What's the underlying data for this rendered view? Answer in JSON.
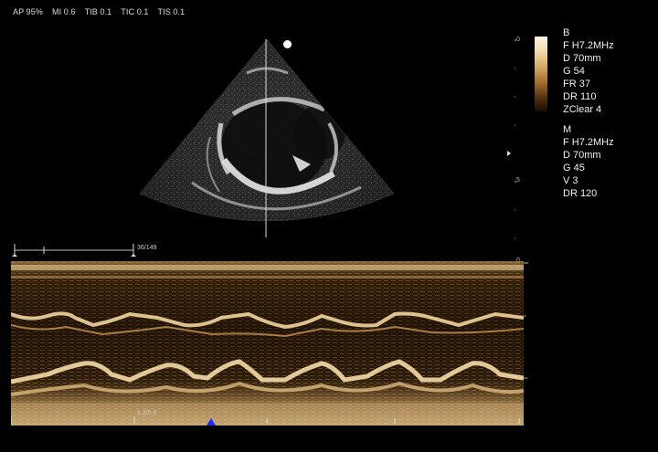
{
  "header": {
    "ap": "AP 95%",
    "mi": "MI 0.6",
    "tib": "TIB 0.1",
    "tic": "TIC 0.1",
    "tis": "TIS 0.1"
  },
  "bmode_params": {
    "title": "B",
    "freq": "F H7.2MHz",
    "depth": "D 70mm",
    "gain": "G 54",
    "frame_rate": "FR 37",
    "dynamic_range": "DR 110",
    "zclear": "ZClear 4"
  },
  "mmode_params": {
    "title": "M",
    "freq": "F H7.2MHz",
    "depth": "D 70mm",
    "gain": "G 45",
    "speed": "V 3",
    "dynamic_range": "DR 120"
  },
  "scale": {
    "top_zero": "0",
    "five": "5",
    "mmode_zero": "0"
  },
  "cine": {
    "frame_counter": "36/149",
    "time": "1.2/5.0"
  },
  "colors": {
    "background": "#000000",
    "echo_warm": "#e3b46a",
    "marker_blue": "#1a2cff"
  }
}
